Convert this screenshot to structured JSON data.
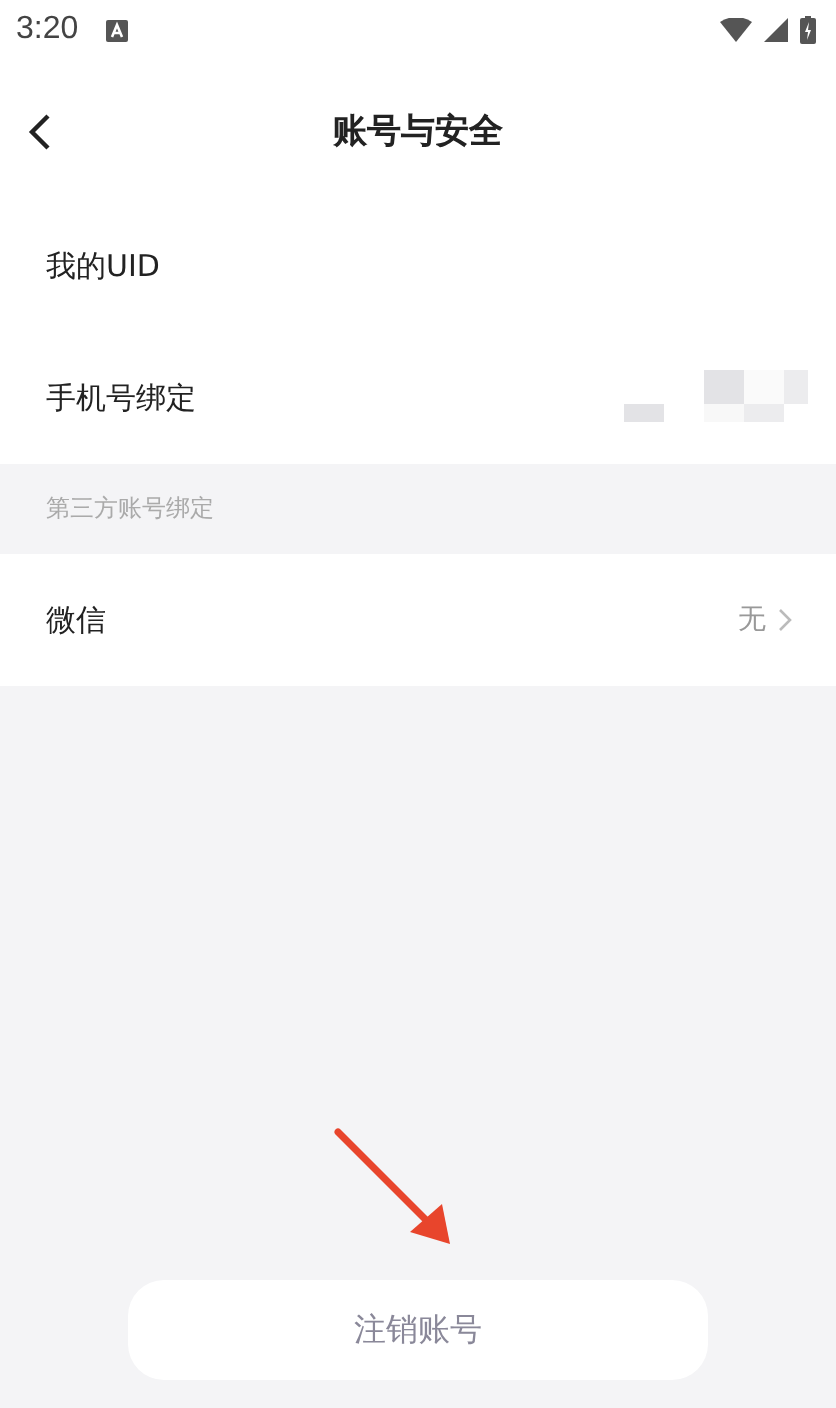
{
  "status_bar": {
    "time": "3:20"
  },
  "header": {
    "title": "账号与安全"
  },
  "sections": [
    {
      "rows": [
        {
          "kind": "plain",
          "label": "我的UID"
        },
        {
          "kind": "pixelated",
          "label": "手机号绑定"
        }
      ]
    },
    {
      "title": "第三方账号绑定",
      "rows": [
        {
          "kind": "link",
          "label": "微信",
          "value": "无"
        }
      ]
    }
  ],
  "footer_button": "注销账号"
}
